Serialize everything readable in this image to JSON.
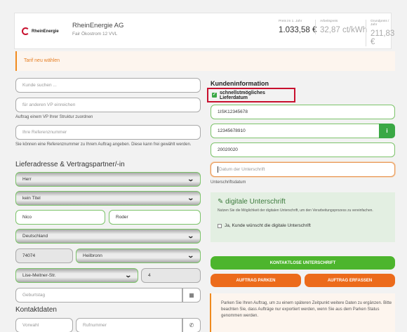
{
  "tariff": {
    "logo_text": "RheinEnergie",
    "provider": "RheinEnergie AG",
    "name": "Fair Ökostrom 12 VVL",
    "prices": [
      {
        "label": "Preis im 1. Jahr",
        "value": "1.033,58 €"
      },
      {
        "label": "Arbeitspreis",
        "value": "32,87 ct/kWh"
      },
      {
        "label": "Grundpreis / Jahr",
        "value": "211,83 €"
      }
    ]
  },
  "alert": {
    "text": "Tarif neu wählen"
  },
  "left": {
    "customer_search_placeholder": "Kunde suchen ...",
    "other_vp_placeholder": "für anderen VP einreichen",
    "other_vp_helper": "Auftrag einem VP Ihrer Struktur zuordnen",
    "reference_placeholder": "Ihre Referenznummer",
    "reference_helper": "Sie können eine Referenznummer zu Ihrem Auftrag angeben. Diese kann frei gewählt werden.",
    "delivery_heading": "Lieferadresse & Vertragspartner/-in",
    "salutation": "Herr",
    "title": "kein Titel",
    "first_name": "Nico",
    "last_name": "Roder",
    "country": "Deutschland",
    "zip": "74074",
    "city": "Heilbronn",
    "street": "Lise-Meitner-Str.",
    "house_number": "4",
    "birthday_placeholder": "Geburtstag",
    "contact_heading": "Kontaktdaten",
    "area_code_placeholder": "Vorwahl",
    "phone_placeholder": "Rufnummer"
  },
  "right": {
    "heading": "Kundeninformation",
    "express_label": "schnellstmögliches Lieferdatum",
    "field1": "1ISK12345678",
    "field2": "12345678910",
    "field3": "20020020",
    "signature_date_placeholder": "Datum der Unterschrift",
    "signature_date_label": "Unterschriftsdatum",
    "digital": {
      "title": "digitale Unterschrift",
      "desc": "Nutzen Sie die Möglichkeit der digitalen Unterschrift, um den Verarbeitungsprozess zu vereinfachen.",
      "checkbox_label": "Ja, Kunde wünscht die digitale Unterschrift"
    },
    "btn_contactless": "Kontaktlose Unterschrift",
    "btn_park": "Auftrag parken",
    "btn_submit": "Auftrag erfassen",
    "note": "Parken Sie Ihren Auftrag, um zu einem späteren Zeitpunkt weitere Daten zu ergänzen. Bitte beachten Sie, dass Aufträge nur exportiert werden, wenn Sie aus dem Parken Status genommen werden."
  },
  "colors": {
    "accent_green": "#4db52d",
    "accent_orange": "#ec6b1b",
    "brand_red": "#c8102e"
  }
}
